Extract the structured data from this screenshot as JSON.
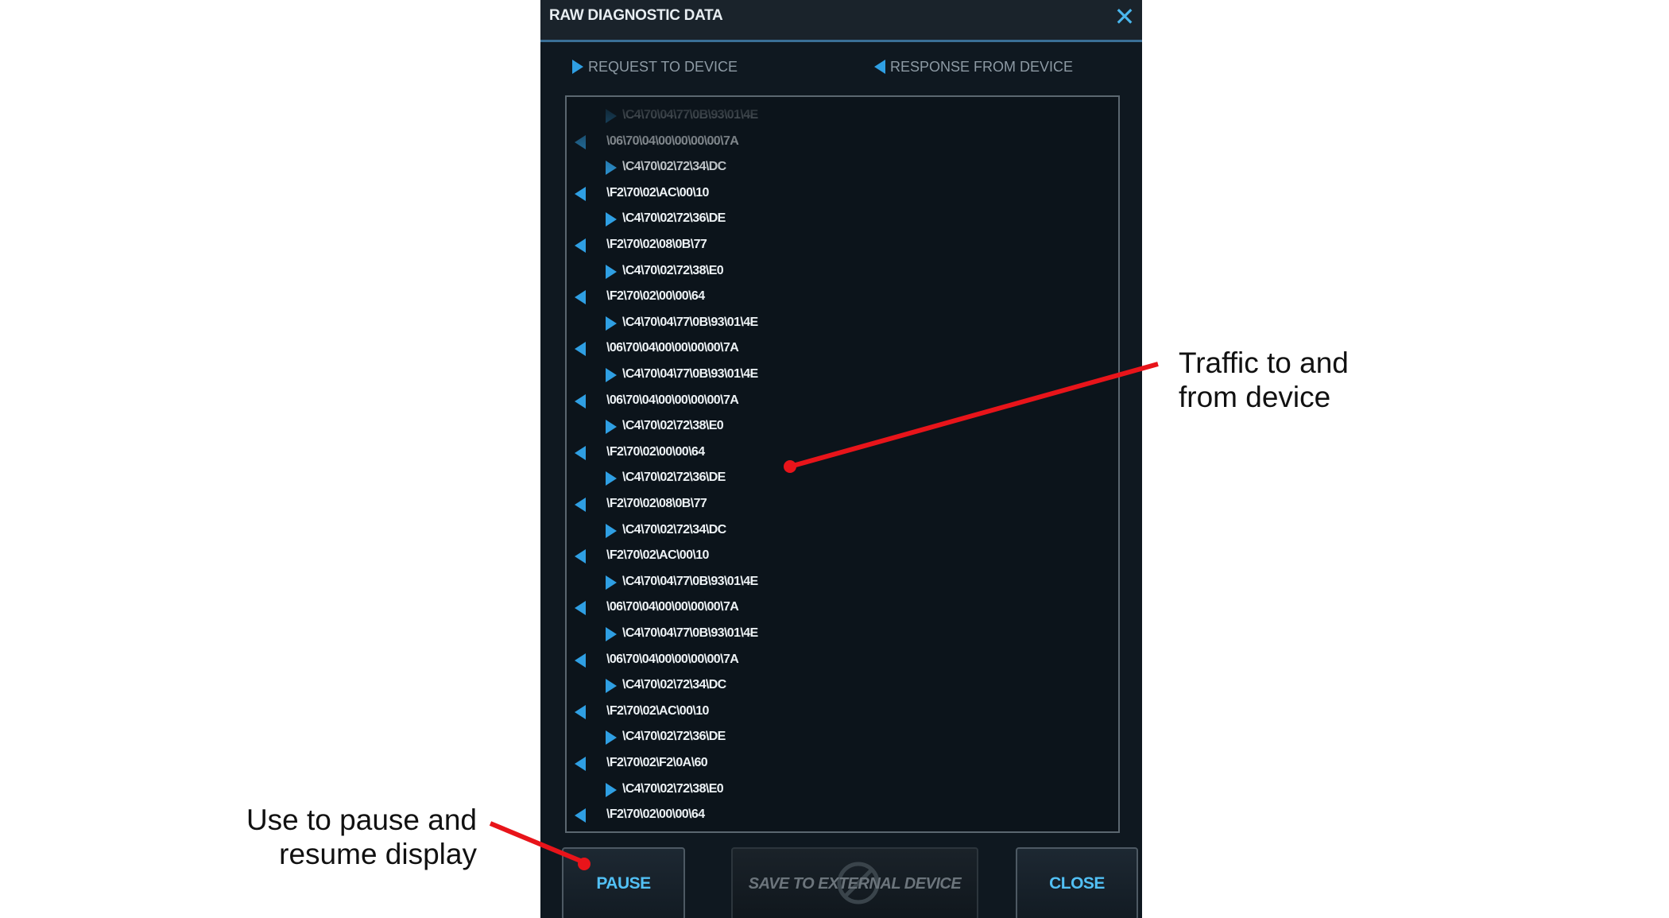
{
  "dialog": {
    "title": "RAW DIAGNOSTIC DATA",
    "close_icon": "close-x-icon",
    "legend": {
      "request_label": "REQUEST TO DEVICE",
      "response_label": "RESPONSE FROM DEVICE"
    },
    "log_lines": [
      {
        "dir": "request",
        "text": "\\C4\\70\\04\\77\\0B\\93\\01\\4E"
      },
      {
        "dir": "response",
        "text": "\\06\\70\\04\\00\\00\\00\\00\\7A"
      },
      {
        "dir": "request",
        "text": "\\C4\\70\\02\\72\\34\\DC"
      },
      {
        "dir": "response",
        "text": "\\F2\\70\\02\\AC\\00\\10"
      },
      {
        "dir": "request",
        "text": "\\C4\\70\\02\\72\\36\\DE"
      },
      {
        "dir": "response",
        "text": "\\F2\\70\\02\\08\\0B\\77"
      },
      {
        "dir": "request",
        "text": "\\C4\\70\\02\\72\\38\\E0"
      },
      {
        "dir": "response",
        "text": "\\F2\\70\\02\\00\\00\\64"
      },
      {
        "dir": "request",
        "text": "\\C4\\70\\04\\77\\0B\\93\\01\\4E"
      },
      {
        "dir": "response",
        "text": "\\06\\70\\04\\00\\00\\00\\00\\7A"
      },
      {
        "dir": "request",
        "text": "\\C4\\70\\04\\77\\0B\\93\\01\\4E"
      },
      {
        "dir": "response",
        "text": "\\06\\70\\04\\00\\00\\00\\00\\7A"
      },
      {
        "dir": "request",
        "text": "\\C4\\70\\02\\72\\38\\E0"
      },
      {
        "dir": "response",
        "text": "\\F2\\70\\02\\00\\00\\64"
      },
      {
        "dir": "request",
        "text": "\\C4\\70\\02\\72\\36\\DE"
      },
      {
        "dir": "response",
        "text": "\\F2\\70\\02\\08\\0B\\77"
      },
      {
        "dir": "request",
        "text": "\\C4\\70\\02\\72\\34\\DC"
      },
      {
        "dir": "response",
        "text": "\\F2\\70\\02\\AC\\00\\10"
      },
      {
        "dir": "request",
        "text": "\\C4\\70\\04\\77\\0B\\93\\01\\4E"
      },
      {
        "dir": "response",
        "text": "\\06\\70\\04\\00\\00\\00\\00\\7A"
      },
      {
        "dir": "request",
        "text": "\\C4\\70\\04\\77\\0B\\93\\01\\4E"
      },
      {
        "dir": "response",
        "text": "\\06\\70\\04\\00\\00\\00\\00\\7A"
      },
      {
        "dir": "request",
        "text": "\\C4\\70\\02\\72\\34\\DC"
      },
      {
        "dir": "response",
        "text": "\\F2\\70\\02\\AC\\00\\10"
      },
      {
        "dir": "request",
        "text": "\\C4\\70\\02\\72\\36\\DE"
      },
      {
        "dir": "response",
        "text": "\\F2\\70\\02\\F2\\0A\\60"
      },
      {
        "dir": "request",
        "text": "\\C4\\70\\02\\72\\38\\E0"
      },
      {
        "dir": "response",
        "text": "\\F2\\70\\02\\00\\00\\64"
      }
    ],
    "buttons": {
      "pause_label": "PAUSE",
      "save_label": "SAVE TO EXTERNAL DEVICE",
      "save_disabled_icon": "disabled-icon",
      "close_label": "CLOSE"
    }
  },
  "annotations": {
    "traffic_line1": "Traffic to and",
    "traffic_line2": "from device",
    "pause_line1": "Use to pause and",
    "pause_line2": "resume display"
  },
  "colors": {
    "accent": "#2f9fe3",
    "button_text": "#52c0f4",
    "dialog_bg": "#0f1820",
    "callout_red": "#e8141a"
  }
}
